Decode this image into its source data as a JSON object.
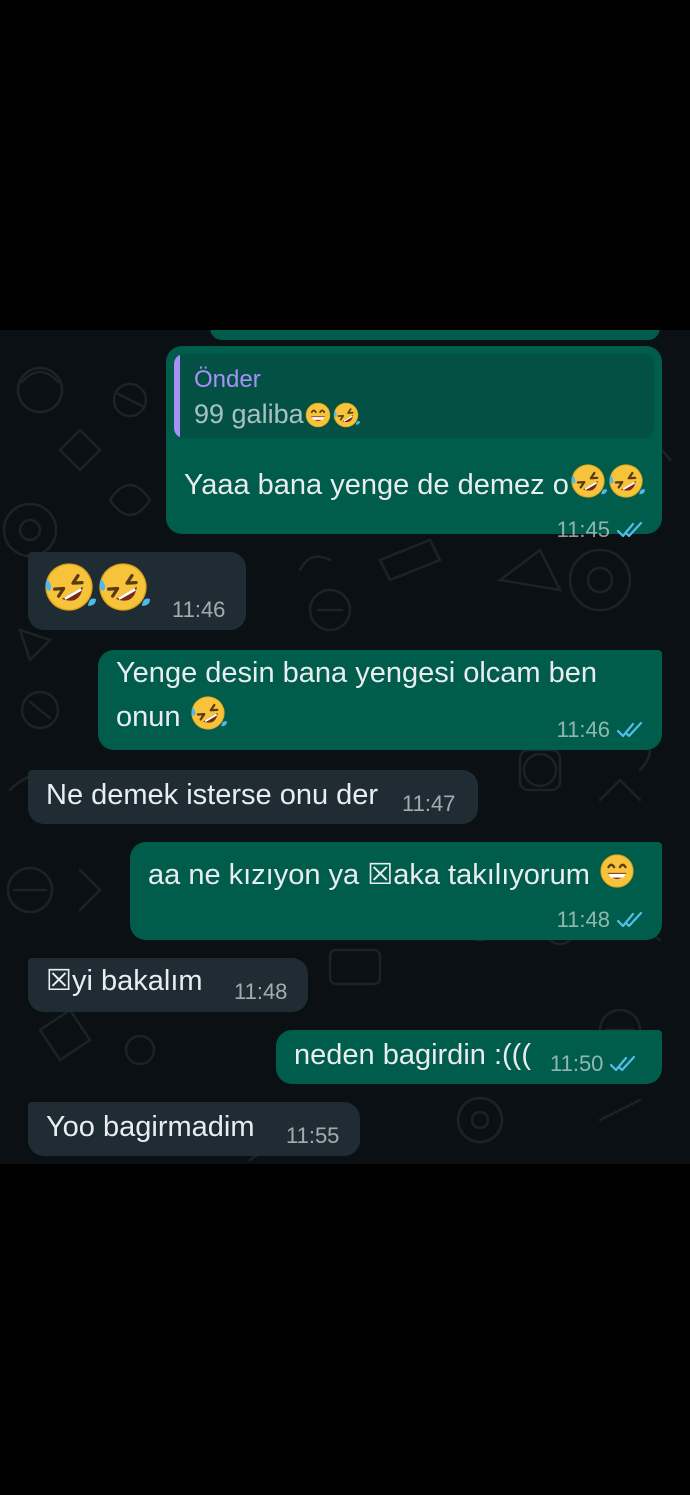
{
  "messages": [
    {
      "direction": "outgoing",
      "quote": {
        "author": "Önder",
        "text": "99 galiba"
      },
      "text": "Yaaa bana yenge de demez o",
      "time": "11:45",
      "status": "read"
    },
    {
      "direction": "incoming",
      "text": "",
      "time": "11:46"
    },
    {
      "direction": "outgoing",
      "line1": "Yenge desin bana yengesi olcam ben",
      "line2": "onun",
      "time": "11:46",
      "status": "read"
    },
    {
      "direction": "incoming",
      "text": "Ne demek isterse onu der",
      "time": "11:47"
    },
    {
      "direction": "outgoing",
      "text": "aa ne kızıyon ya ☒aka takılıyorum",
      "time": "11:48",
      "status": "read"
    },
    {
      "direction": "incoming",
      "text": "☒yi bakalım",
      "time": "11:48"
    },
    {
      "direction": "outgoing",
      "text": "neden bagirdin :(((",
      "time": "11:50",
      "status": "read"
    },
    {
      "direction": "incoming",
      "text": "Yoo bagirmadim",
      "time": "11:55"
    }
  ],
  "icons": {
    "grinning": "grinning-face-icon",
    "rofl": "rolling-on-floor-laughing-icon",
    "read_ticks": "double-check-icon"
  },
  "colors": {
    "outgoing_bubble": "#005c4b",
    "incoming_bubble": "#1f2c34",
    "chat_background": "#0b1014",
    "quote_accent": "#a791f7",
    "read_tick": "#53bdeb"
  }
}
